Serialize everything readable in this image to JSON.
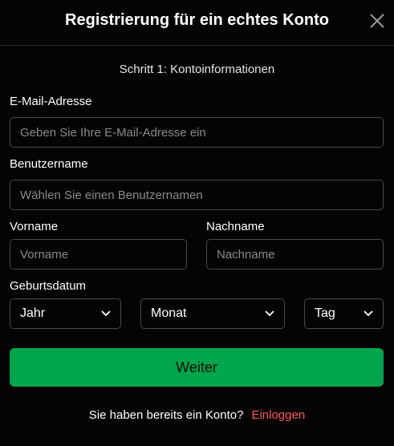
{
  "header": {
    "title": "Registrierung für ein echtes Konto",
    "close_icon": "close-icon"
  },
  "step": "Schritt 1: Kontoinformationen",
  "form": {
    "email": {
      "label": "E-Mail-Adresse",
      "placeholder": "Geben Sie Ihre E-Mail-Adresse ein",
      "value": ""
    },
    "username": {
      "label": "Benutzername",
      "placeholder": "Wählen Sie einen Benutzernamen",
      "value": ""
    },
    "firstname": {
      "label": "Vorname",
      "placeholder": "Vorname",
      "value": ""
    },
    "lastname": {
      "label": "Nachname",
      "placeholder": "Nachname",
      "value": ""
    },
    "birthdate": {
      "label": "Geburtsdatum",
      "year": "Jahr",
      "month": "Monat",
      "day": "Tag"
    }
  },
  "submit_label": "Weiter",
  "footer": {
    "question": "Sie haben bereits ein Konto?",
    "login_label": "Einloggen"
  },
  "colors": {
    "background": "#050304",
    "accent_green": "#00a54c",
    "link_red": "#ff5a5a",
    "border": "#4a4a4a"
  }
}
